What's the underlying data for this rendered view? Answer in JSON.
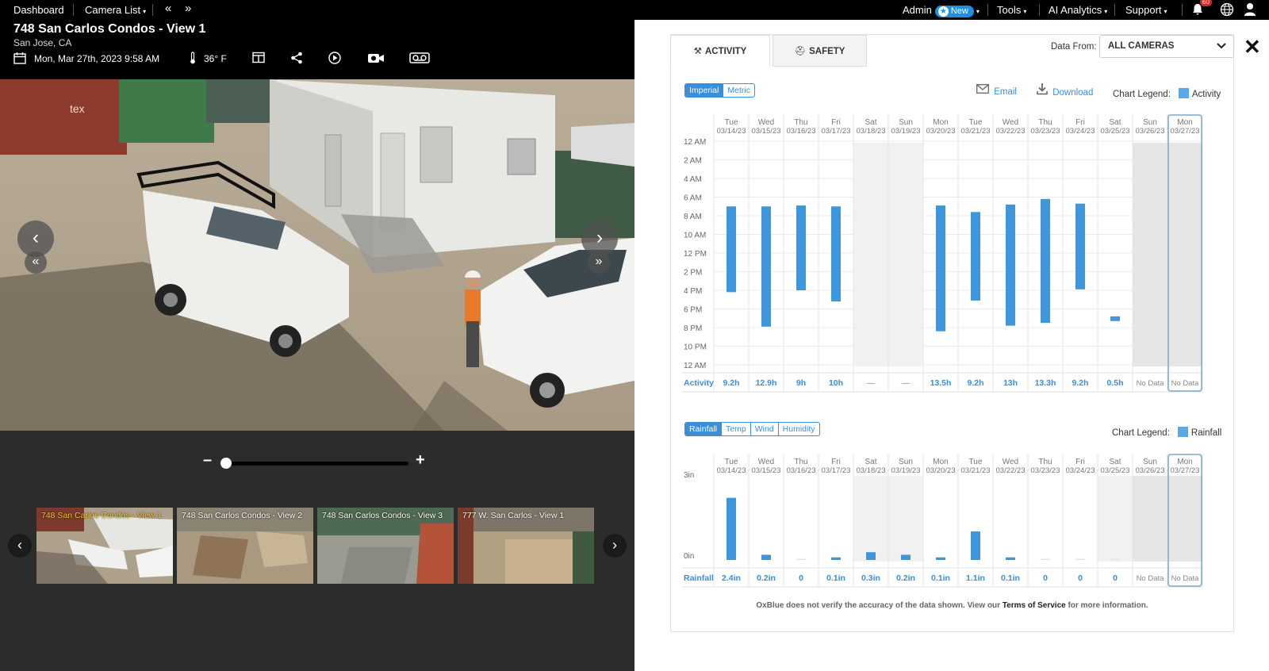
{
  "nav": {
    "dashboard": "Dashboard",
    "camera_list": "Camera List",
    "admin": "Admin",
    "new_badge": "New",
    "tools": "Tools",
    "ai_analytics": "AI Analytics",
    "support": "Support",
    "notifications_count": "60"
  },
  "camera": {
    "title": "748 San Carlos Condos - View 1",
    "location": "San Jose, CA",
    "datetime": "Mon, Mar 27th, 2023 9:58 AM",
    "temperature": "36° F"
  },
  "thumbnails": [
    {
      "label": "748 San Carlos Condos - View 1",
      "active": true
    },
    {
      "label": "748 San Carlos Condos - View 2",
      "active": false
    },
    {
      "label": "748 San Carlos Condos - View 3",
      "active": false
    },
    {
      "label": "777 W. San Carlos - View 1",
      "active": false
    }
  ],
  "panel": {
    "tabs": [
      "ACTIVITY",
      "SAFETY"
    ],
    "active_tab": "ACTIVITY",
    "data_from_label": "Data From:",
    "data_from_value": "ALL CAMERAS",
    "units": [
      "Imperial",
      "Metric"
    ],
    "active_unit": "Imperial",
    "email": "Email",
    "download": "Download",
    "chart_legend_label": "Chart Legend:",
    "activity_legend": "Activity",
    "weather_tabs": [
      "Rainfall",
      "Temp",
      "Wind",
      "Humidity"
    ],
    "active_weather": "Rainfall",
    "rainfall_legend": "Rainfall",
    "footer_prefix": "OxBlue does not verify the accuracy of the data shown. View our ",
    "footer_link": "Terms of Service",
    "footer_suffix": " for more information."
  },
  "chart_data": [
    {
      "type": "bar",
      "subtype": "floating-range",
      "legend": "Activity",
      "row_label": "Activity",
      "days": [
        "Tue",
        "Wed",
        "Thu",
        "Fri",
        "Sat",
        "Sun",
        "Mon",
        "Tue",
        "Wed",
        "Thu",
        "Fri",
        "Sat",
        "Sun",
        "Mon"
      ],
      "dates": [
        "03/14/23",
        "03/15/23",
        "03/16/23",
        "03/17/23",
        "03/18/23",
        "03/19/23",
        "03/20/23",
        "03/21/23",
        "03/22/23",
        "03/23/23",
        "03/24/23",
        "03/25/23",
        "03/26/23",
        "03/27/23"
      ],
      "y_ticks": [
        "12 AM",
        "2 AM",
        "4 AM",
        "6 AM",
        "8 AM",
        "10 AM",
        "12 PM",
        "2 PM",
        "4 PM",
        "6 PM",
        "8 PM",
        "10 PM",
        "12 AM"
      ],
      "ylim_hours": [
        0,
        24
      ],
      "start_hour": [
        7.0,
        7.0,
        6.9,
        7.0,
        null,
        null,
        6.9,
        7.6,
        6.8,
        6.2,
        6.7,
        18.8,
        null,
        null
      ],
      "end_hour": [
        16.2,
        19.9,
        16.0,
        17.2,
        null,
        null,
        20.4,
        17.1,
        19.8,
        19.5,
        15.9,
        19.3,
        null,
        null
      ],
      "totals": [
        "9.2h",
        "12.9h",
        "9h",
        "10h",
        "—",
        "—",
        "13.5h",
        "9.2h",
        "13h",
        "13.3h",
        "9.2h",
        "0.5h",
        "No Data",
        "No Data"
      ],
      "weekend_shaded": [
        false,
        false,
        false,
        false,
        true,
        true,
        false,
        false,
        false,
        false,
        false,
        false,
        true,
        true
      ],
      "highlighted_column": 13,
      "grid": true
    },
    {
      "type": "bar",
      "legend": "Rainfall",
      "row_label": "Rainfall",
      "days": [
        "Tue",
        "Wed",
        "Thu",
        "Fri",
        "Sat",
        "Sun",
        "Mon",
        "Tue",
        "Wed",
        "Thu",
        "Fri",
        "Sat",
        "Sun",
        "Mon"
      ],
      "dates": [
        "03/14/23",
        "03/15/23",
        "03/16/23",
        "03/17/23",
        "03/18/23",
        "03/19/23",
        "03/20/23",
        "03/21/23",
        "03/22/23",
        "03/23/23",
        "03/24/23",
        "03/25/23",
        "03/26/23",
        "03/27/23"
      ],
      "y_ticks": [
        "3in",
        "0in"
      ],
      "ylim": [
        0,
        3
      ],
      "values": [
        2.4,
        0.2,
        0,
        0.1,
        0.3,
        0.2,
        0.1,
        1.1,
        0.1,
        0,
        0,
        0,
        null,
        null
      ],
      "labels": [
        "2.4in",
        "0.2in",
        "0",
        "0.1in",
        "0.3in",
        "0.2in",
        "0.1in",
        "1.1in",
        "0.1in",
        "0",
        "0",
        "0",
        "No Data",
        "No Data"
      ],
      "weekend_shaded": [
        false,
        false,
        false,
        false,
        true,
        true,
        false,
        false,
        false,
        false,
        false,
        true,
        true,
        true
      ],
      "highlighted_column": 13,
      "grid": true
    }
  ],
  "colors": {
    "accent": "#3a8fd8",
    "bar": "#3f97db",
    "weekend": "#f1f1f1",
    "no_data": "#e6e6e6"
  }
}
